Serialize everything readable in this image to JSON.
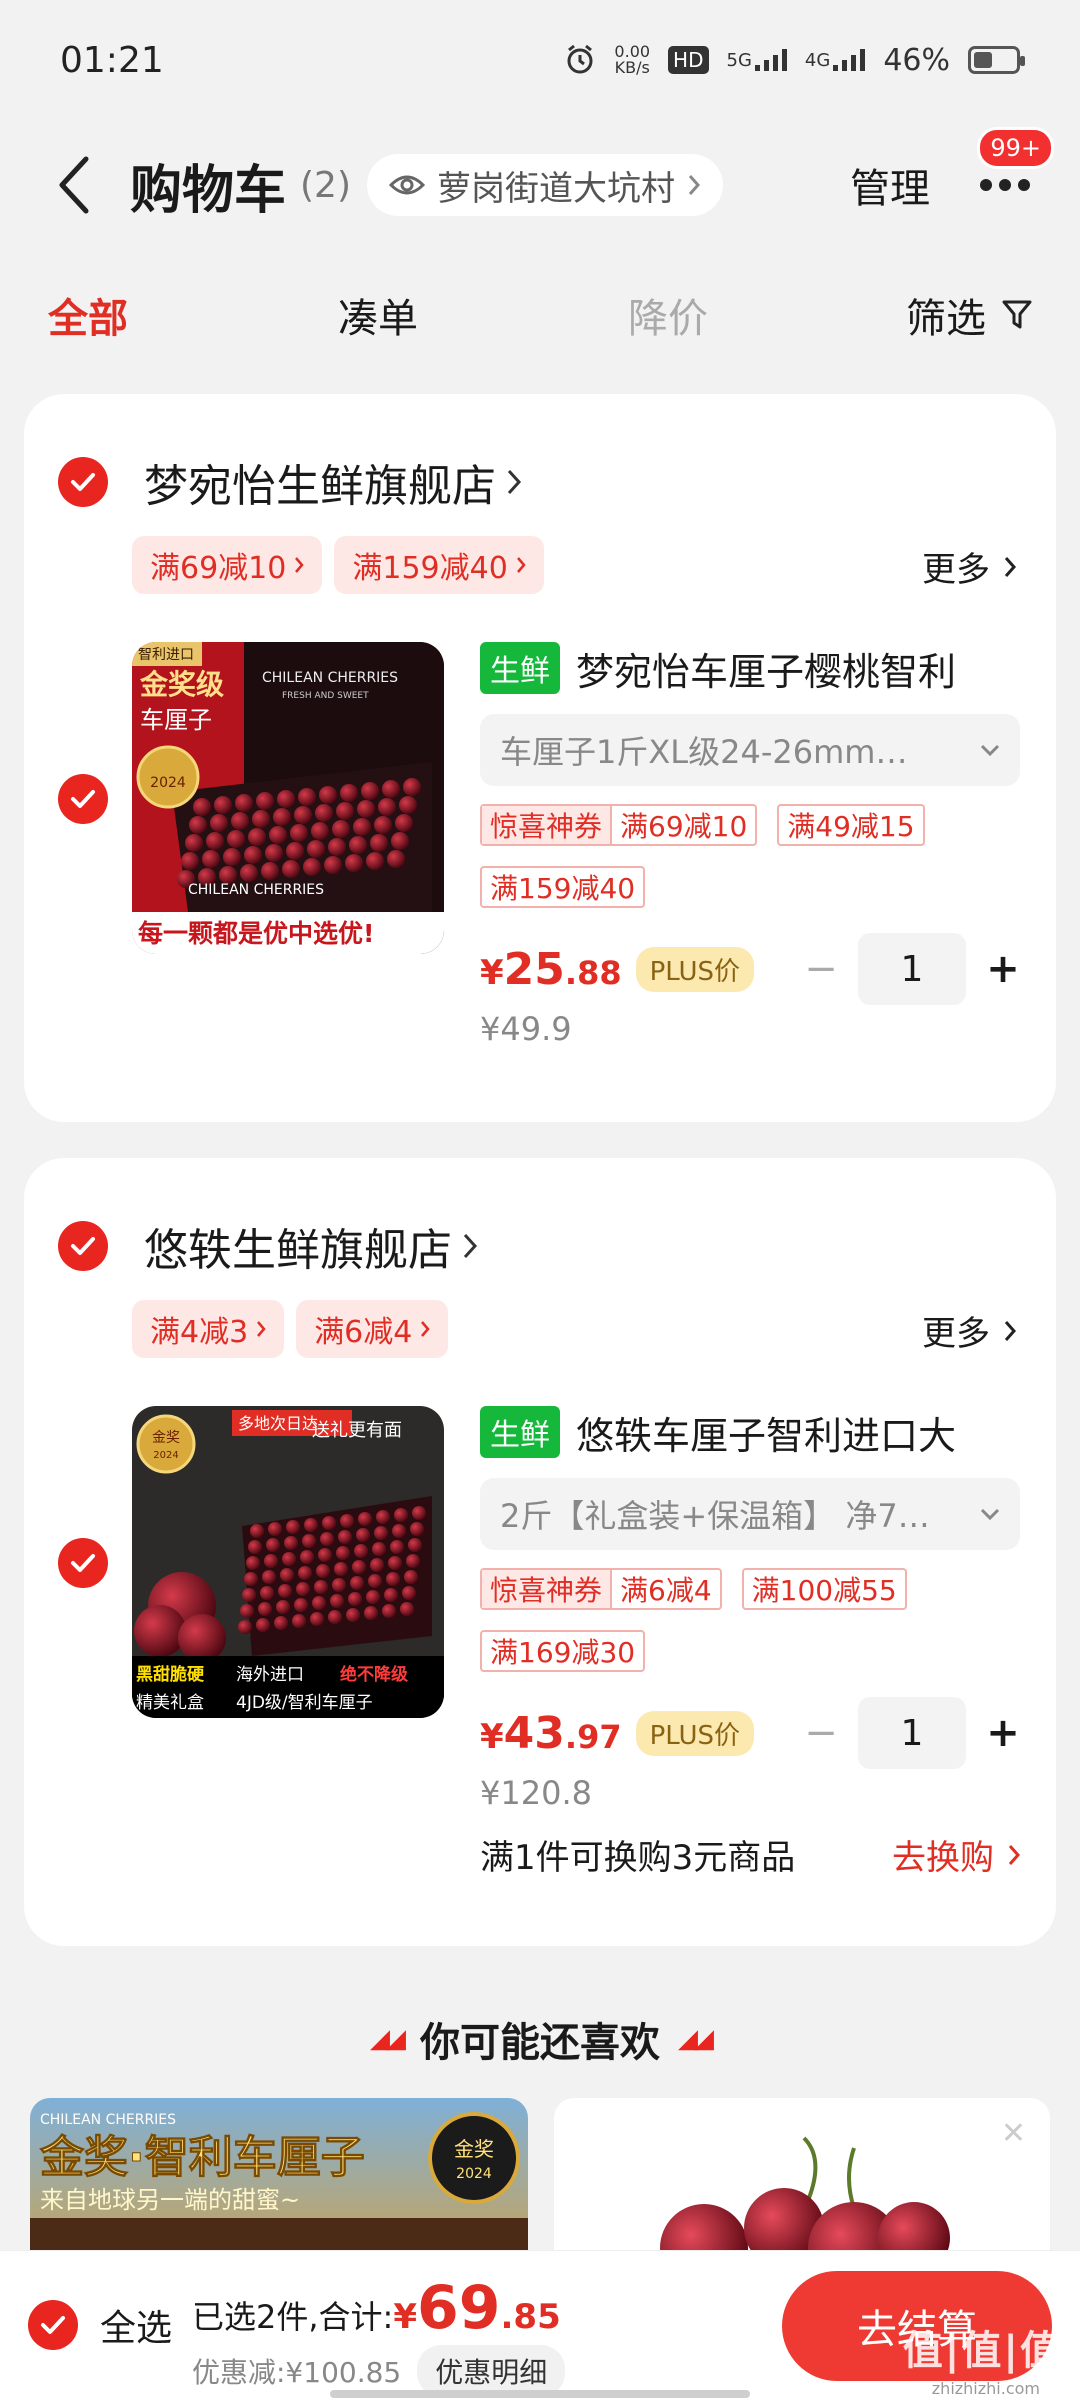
{
  "status_bar": {
    "time": "01:21",
    "speed_value": "0.00",
    "speed_unit": "KB/s",
    "hd": "HD",
    "net1": "5G",
    "net2": "4G",
    "battery": "46%",
    "battery_level": 0.46
  },
  "header": {
    "title": "购物车",
    "count": "(2)",
    "location": "萝岗街道大坑村",
    "manage": "管理",
    "badge": "99+"
  },
  "tabs": {
    "all": "全部",
    "bundle": "凑单",
    "price_drop": "降价",
    "filter": "筛选"
  },
  "stores": [
    {
      "name": "梦宛怡生鲜旗舰店",
      "promos": [
        "满69减10",
        "满159减40"
      ],
      "more": "更多",
      "item": {
        "tag": "生鲜",
        "title": "梦宛怡车厘子樱桃智利",
        "spec": "车厘子1斤XL级24-26mm…",
        "coupon_label": "惊喜神券",
        "coupons": [
          "满69减10",
          "满49减15",
          "满159减40"
        ],
        "price_currency": "¥",
        "price_int": "25",
        "price_dec": ".88",
        "plus": "PLUS价",
        "qty": "1",
        "original_price": "¥49.9",
        "img_text": {
          "badge": "智利进口",
          "gold": "金奖级",
          "name": "车厘子",
          "box": "CHILEAN CHERRIES",
          "box_sub": "FRESH AND SWEET",
          "box_bottom": "CHILEAN CHERRIES",
          "slogan": "每一颗都是优中选优!",
          "medal_year": "2024"
        }
      }
    },
    {
      "name": "悠轶生鲜旗舰店",
      "promos": [
        "满4减3",
        "满6减4"
      ],
      "more": "更多",
      "item": {
        "tag": "生鲜",
        "title": "悠轶车厘子智利进口大",
        "spec": "2斤【礼盒装+保温箱】 净7…",
        "coupon_label": "惊喜神券",
        "coupons": [
          "满6减4",
          "满100减55",
          "满169减30"
        ],
        "price_currency": "¥",
        "price_int": "43",
        "price_dec": ".97",
        "plus": "PLUS价",
        "qty": "1",
        "original_price": "¥120.8",
        "exchange_text": "满1件可换购3元商品",
        "exchange_link": "去换购",
        "img_text": {
          "delivery": "多地次日达",
          "gift": "送礼更有面",
          "medal": "金奖",
          "medal_year": "2024",
          "label1": "黑甜脆硬",
          "label2": "精美礼盒",
          "label3": "海外进口",
          "label4": "绝不降级",
          "label5": "4JD级/智利车厘子"
        }
      }
    }
  ],
  "recommend": {
    "title": "你可能还喜欢",
    "left_banner_top": "CHILEAN CHERRIES",
    "left_banner_title": "金奖·智利车厘子",
    "left_banner_sub": "来自地球另一端的甜蜜~",
    "left_medal": "金奖",
    "left_medal_year": "2024"
  },
  "bottom": {
    "select_all": "全选",
    "selected_text": "已选2件,合计:",
    "total_currency": "¥",
    "total_int": "69",
    "total_dec": ".85",
    "discount": "优惠减:¥100.85",
    "detail": "优惠明细",
    "checkout": "去结算",
    "watermark": "值|值|值",
    "watermark_site": "zhizhizhi.com"
  },
  "colors": {
    "accent": "#e02e24",
    "check": "#e8261f",
    "fresh_tag": "#15b83a",
    "plus_bg": "#fbe9b0"
  }
}
